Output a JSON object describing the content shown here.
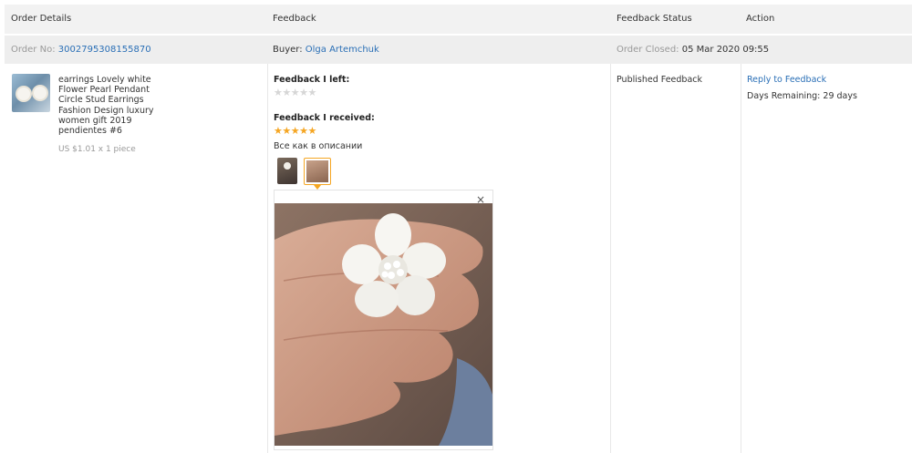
{
  "header": {
    "order_details": "Order Details",
    "feedback": "Feedback",
    "feedback_status": "Feedback Status",
    "action": "Action"
  },
  "order": {
    "order_no_label": "Order No:",
    "order_no": "3002795308155870",
    "buyer_label": "Buyer:",
    "buyer_name": "Olga Artemchuk",
    "closed_label": "Order Closed:",
    "closed_date": "05 Mar 2020 09:55"
  },
  "product": {
    "title": "earrings Lovely white Flower Pearl Pendant Circle Stud Earrings Fashion Design luxury women gift 2019 pendientes #6",
    "price": "US $1.01 x 1 piece"
  },
  "feedback": {
    "left_label": "Feedback I left:",
    "left_stars": "★★★★★",
    "left_rating": 0,
    "received_label": "Feedback I received:",
    "received_stars": "★★★★★",
    "received_rating": 5,
    "received_text": "Все как в описании",
    "close_glyph": "×"
  },
  "status": {
    "text": "Published Feedback"
  },
  "action": {
    "reply_label": "Reply to Feedback",
    "days_remaining": "Days Remaining: 29 days"
  },
  "colors": {
    "link": "#2a6fb6",
    "star_active": "#f5a623",
    "star_inactive": "#d6d6d6",
    "header_bg": "#f2f2f2"
  }
}
